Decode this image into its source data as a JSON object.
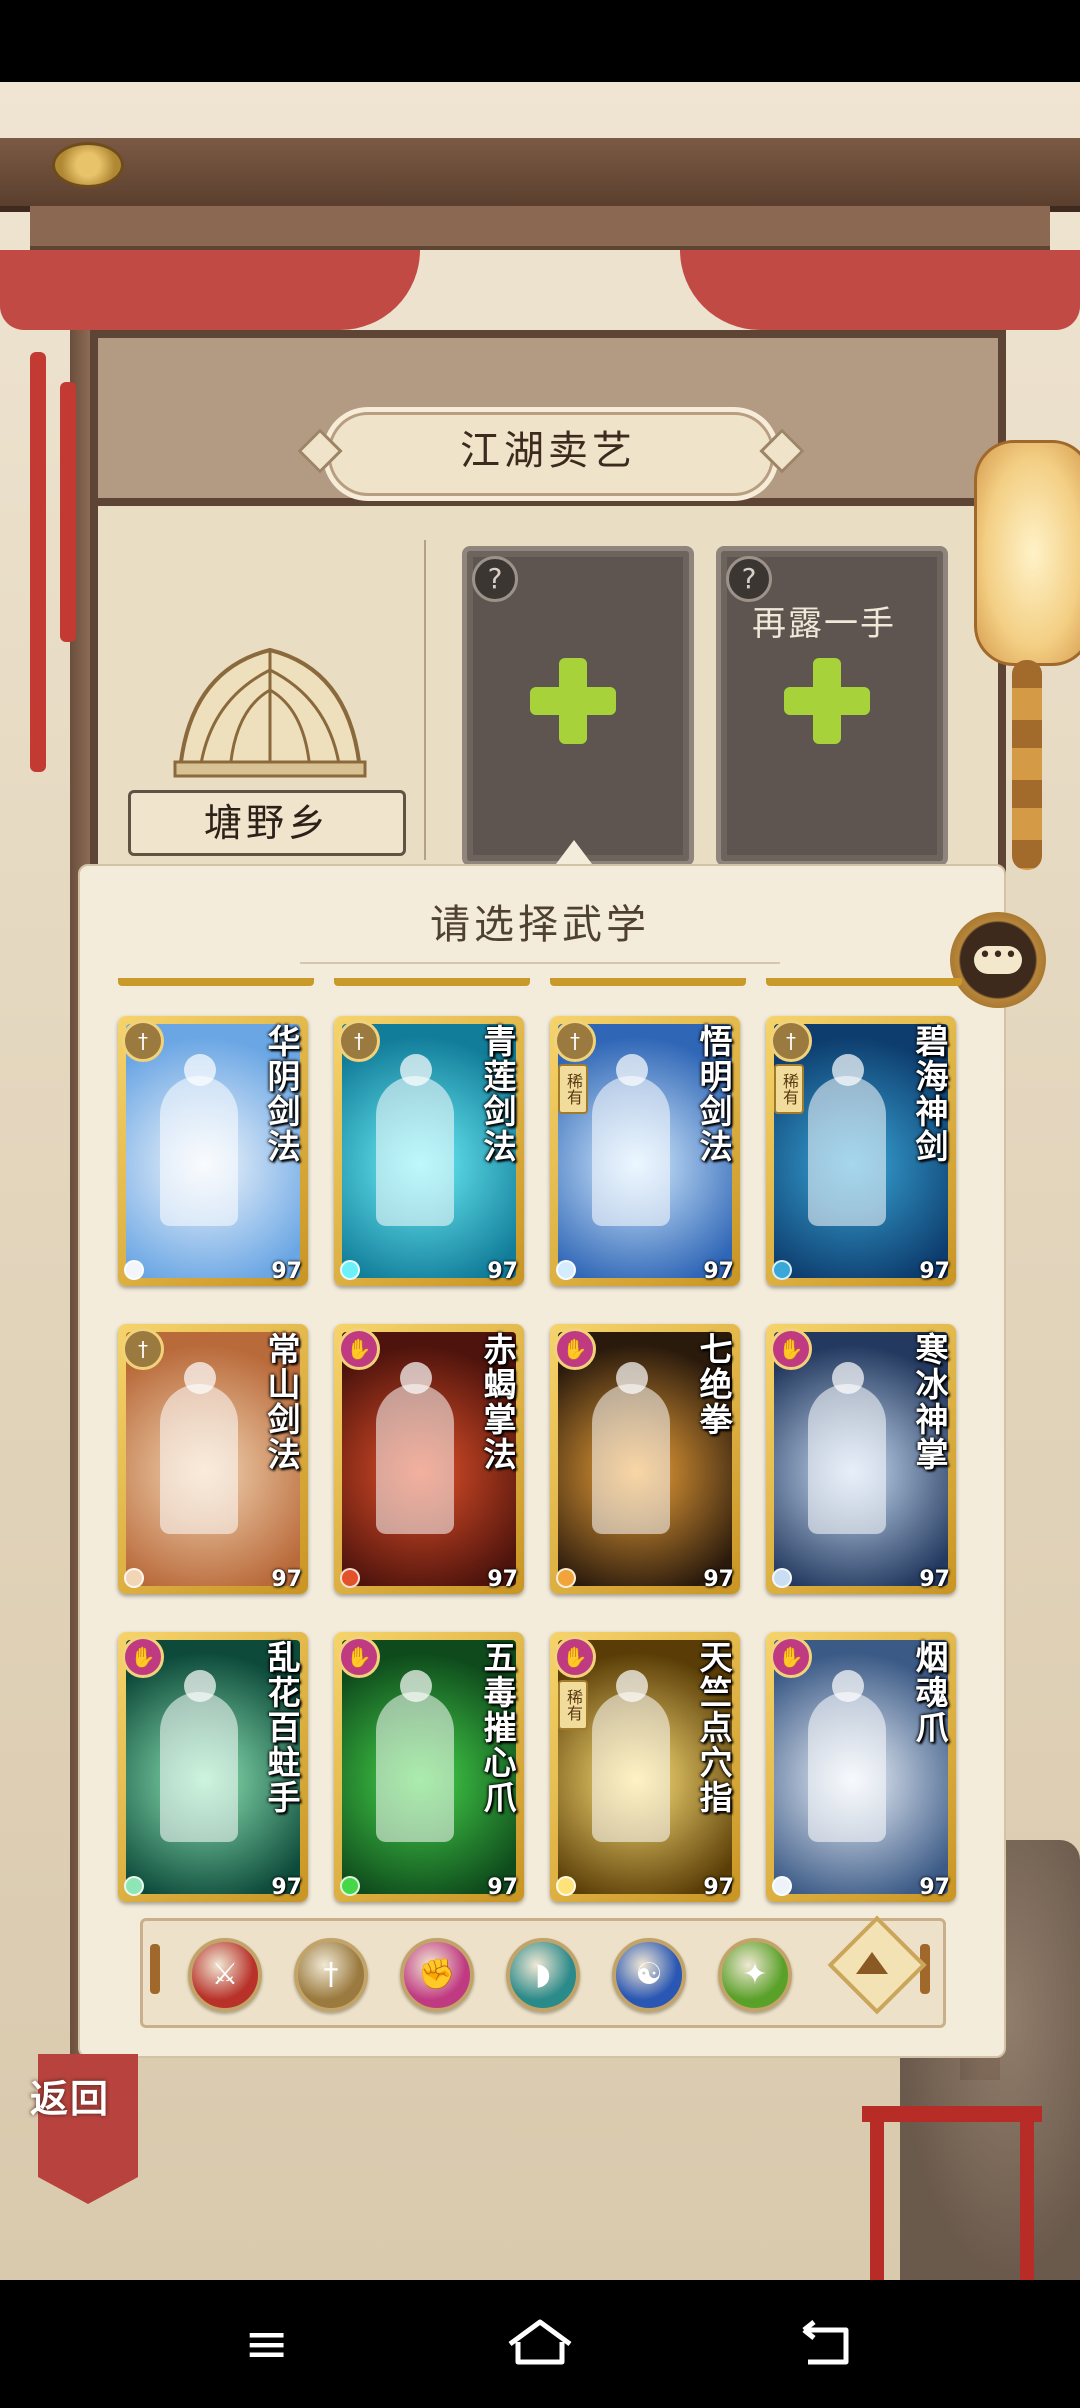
{
  "header": {
    "title": "江湖卖艺"
  },
  "location": {
    "name": "塘野乡",
    "icon": "hut-icon"
  },
  "slots": [
    {
      "caption": "",
      "icon": "plus-icon"
    },
    {
      "caption": "再露一手",
      "icon": "plus-icon"
    }
  ],
  "panel": {
    "title": "请选择武学"
  },
  "cards": [
    {
      "name": "华阴剑法",
      "level": "97",
      "rare": "",
      "badge": "sword-school-icon",
      "colors": [
        "#6aa6e4",
        "#f2f6fb"
      ]
    },
    {
      "name": "青莲剑法",
      "level": "97",
      "rare": "",
      "badge": "sword-school-icon",
      "colors": [
        "#127d9a",
        "#6ef0f8"
      ]
    },
    {
      "name": "悟明剑法",
      "level": "97",
      "rare": "稀有",
      "badge": "sword-school-icon",
      "colors": [
        "#2f66b6",
        "#d4ecff"
      ]
    },
    {
      "name": "碧海神剑",
      "level": "97",
      "rare": "稀有",
      "badge": "sword-school-icon",
      "colors": [
        "#0d3d6e",
        "#39a7d8"
      ]
    },
    {
      "name": "常山剑法",
      "level": "97",
      "rare": "",
      "badge": "sword-school-icon",
      "colors": [
        "#b96a3a",
        "#f2d5b4"
      ]
    },
    {
      "name": "赤蝎掌法",
      "level": "97",
      "rare": "",
      "badge": "palm-school-icon",
      "colors": [
        "#4d130c",
        "#e3512a"
      ]
    },
    {
      "name": "七绝拳",
      "level": "97",
      "rare": "",
      "badge": "palm-school-icon",
      "colors": [
        "#2a1a0c",
        "#f0a43a"
      ]
    },
    {
      "name": "寒冰神掌",
      "level": "97",
      "rare": "",
      "badge": "palm-school-icon",
      "colors": [
        "#23395f",
        "#c9ddf3"
      ]
    },
    {
      "name": "乱花百蛀手",
      "level": "97",
      "rare": "",
      "badge": "palm-school-icon",
      "colors": [
        "#0d4a3a",
        "#8ee6b6"
      ]
    },
    {
      "name": "五毒摧心爪",
      "level": "97",
      "rare": "",
      "badge": "palm-school-icon",
      "colors": [
        "#0e4a1c",
        "#46d64a"
      ]
    },
    {
      "name": "天竺点穴指",
      "level": "97",
      "rare": "稀有",
      "badge": "palm-school-icon",
      "colors": [
        "#5a3d06",
        "#ffe27a"
      ]
    },
    {
      "name": "烟魂爪",
      "level": "97",
      "rare": "",
      "badge": "palm-school-icon",
      "colors": [
        "#3b5a86",
        "#eef3fa"
      ]
    }
  ],
  "filters": [
    {
      "icon": "blade-icon",
      "color": "#b8322a"
    },
    {
      "icon": "sword-icon",
      "color": "#9a7a3e"
    },
    {
      "icon": "fist-icon",
      "color": "#c03a82"
    },
    {
      "icon": "fan-icon",
      "color": "#2b8a8a"
    },
    {
      "icon": "taiji-icon",
      "color": "#2a57b3"
    },
    {
      "icon": "hidden-weapon-icon",
      "color": "#5aa12a"
    }
  ],
  "back": {
    "label": "返回"
  },
  "nav": {
    "menu_icon": "menu-icon",
    "home_icon": "home-icon",
    "back_icon": "back-icon"
  }
}
